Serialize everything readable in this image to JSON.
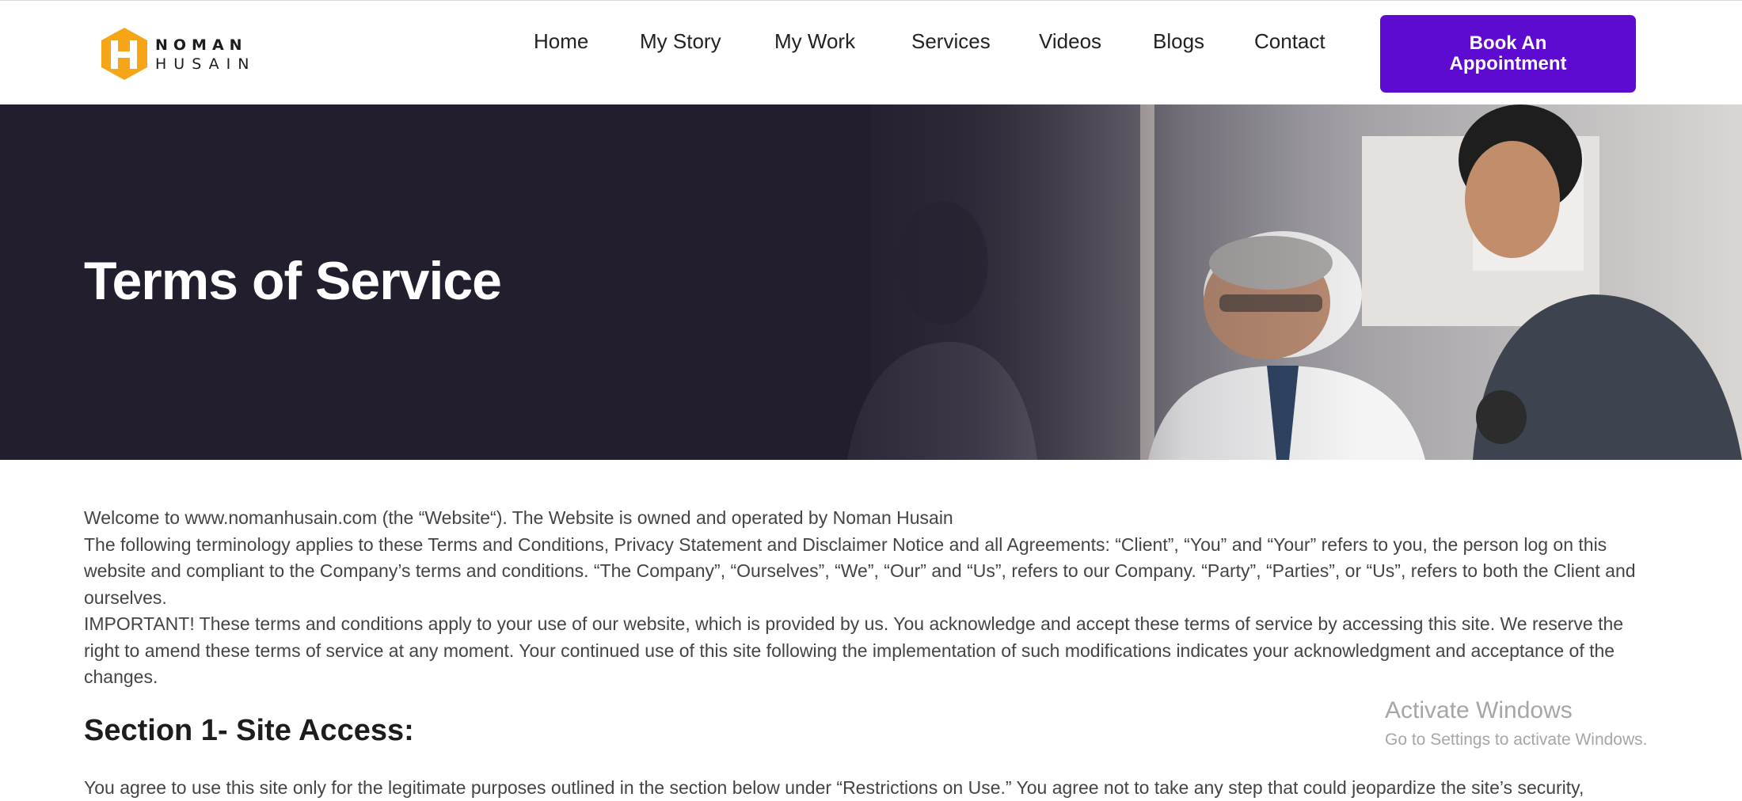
{
  "brand": {
    "logo_text_line1": "NOMAN",
    "logo_text_line2": "HUSAIN",
    "logo_color": "#f5a516"
  },
  "nav": {
    "items": [
      {
        "label": "Home"
      },
      {
        "label": "My Story"
      },
      {
        "label": "My Work"
      },
      {
        "label": "Services"
      },
      {
        "label": "Videos"
      },
      {
        "label": "Blogs"
      },
      {
        "label": "Contact"
      }
    ],
    "cta_line1": "Book An",
    "cta_line2": "Appointment",
    "cta_color": "#5d0bd0"
  },
  "hero": {
    "title": "Terms of Service",
    "overlay_color": "#231e2e"
  },
  "content": {
    "intro_lines": [
      "Welcome to www.nomanhusain.com (the “Website“). The Website is owned and operated by Noman Husain",
      "The following terminology applies to these Terms and Conditions, Privacy Statement and Disclaimer Notice and all Agreements: “Client”, “You” and “Your” refers to you, the person log on this website and compliant to the Company’s terms and conditions. “The Company”, “Ourselves”, “We”, “Our” and “Us”, refers to our Company. “Party”, “Parties”, or “Us”, refers to both the Client and ourselves.",
      "IMPORTANT! These terms and conditions apply to your use of our website, which is provided by us. You acknowledge and accept these terms of service by accessing this site. We reserve the right to amend these terms of service at any moment. Your continued use of this site following the implementation of such modifications indicates your acknowledgment and acceptance of the changes."
    ],
    "section1_heading": "Section 1- Site Access:",
    "section1_text": "You agree to use this site only for the legitimate purposes outlined in the section below under “Restrictions on Use.” You agree not to take any step that could jeopardize the site’s security,"
  },
  "watermark": {
    "title": "Activate Windows",
    "subtitle": "Go to Settings to activate Windows."
  }
}
